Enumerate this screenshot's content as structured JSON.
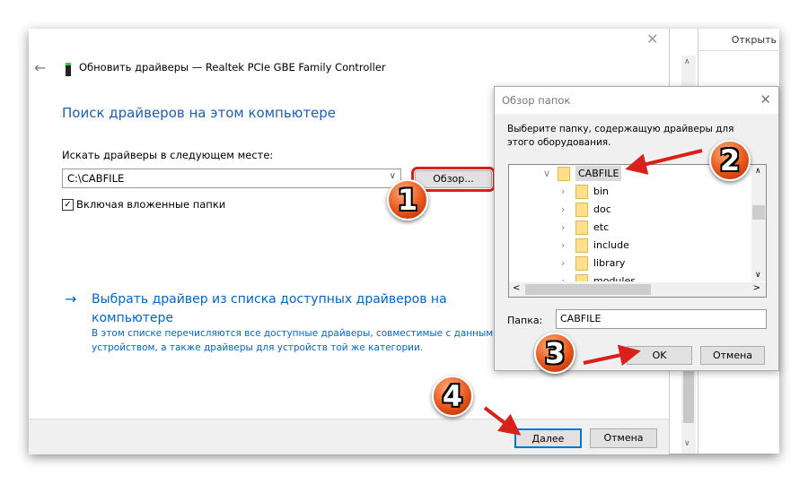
{
  "window": {
    "title": "Обновить драйверы — Realtek PCIe GBE Family Controller",
    "heading": "Поиск драйверов на этом компьютере",
    "search_label": "Искать драйверы в следующем месте:",
    "path_value": "C:\\CABFILE",
    "browse_label": "Обзор...",
    "include_subfolders_label": "Включая вложенные папки",
    "include_subfolders_checked": true,
    "link_title": "Выбрать драйвер из списка доступных драйверов на компьютере",
    "link_description": "В этом списке перечисляются все доступные драйверы, совместимые с данным устройством, а также драйверы для устройств той же категории.",
    "next_label": "Далее",
    "cancel_label": "Отмена",
    "back_icon": "arrow-left-icon",
    "device_icon": "network-adapter-icon"
  },
  "background_panel": {
    "open_label": "Открыть"
  },
  "dialog": {
    "title": "Обзор папок",
    "description": "Выберите папку, содержащую драйверы для этого оборудования.",
    "tree": [
      {
        "label": "CABFILE",
        "expanded": true,
        "selected": true
      },
      {
        "label": "bin"
      },
      {
        "label": "doc"
      },
      {
        "label": "etc"
      },
      {
        "label": "include"
      },
      {
        "label": "library"
      },
      {
        "label": "modules"
      }
    ],
    "folder_label": "Папка:",
    "folder_value": "CABFILE",
    "ok_label": "OK",
    "cancel_label": "Отмена"
  },
  "annotations": {
    "steps": [
      "1",
      "2",
      "3",
      "4"
    ],
    "color": "#d9201a"
  },
  "colors": {
    "accent": "#0066cc",
    "heading": "#1a5fb4"
  }
}
